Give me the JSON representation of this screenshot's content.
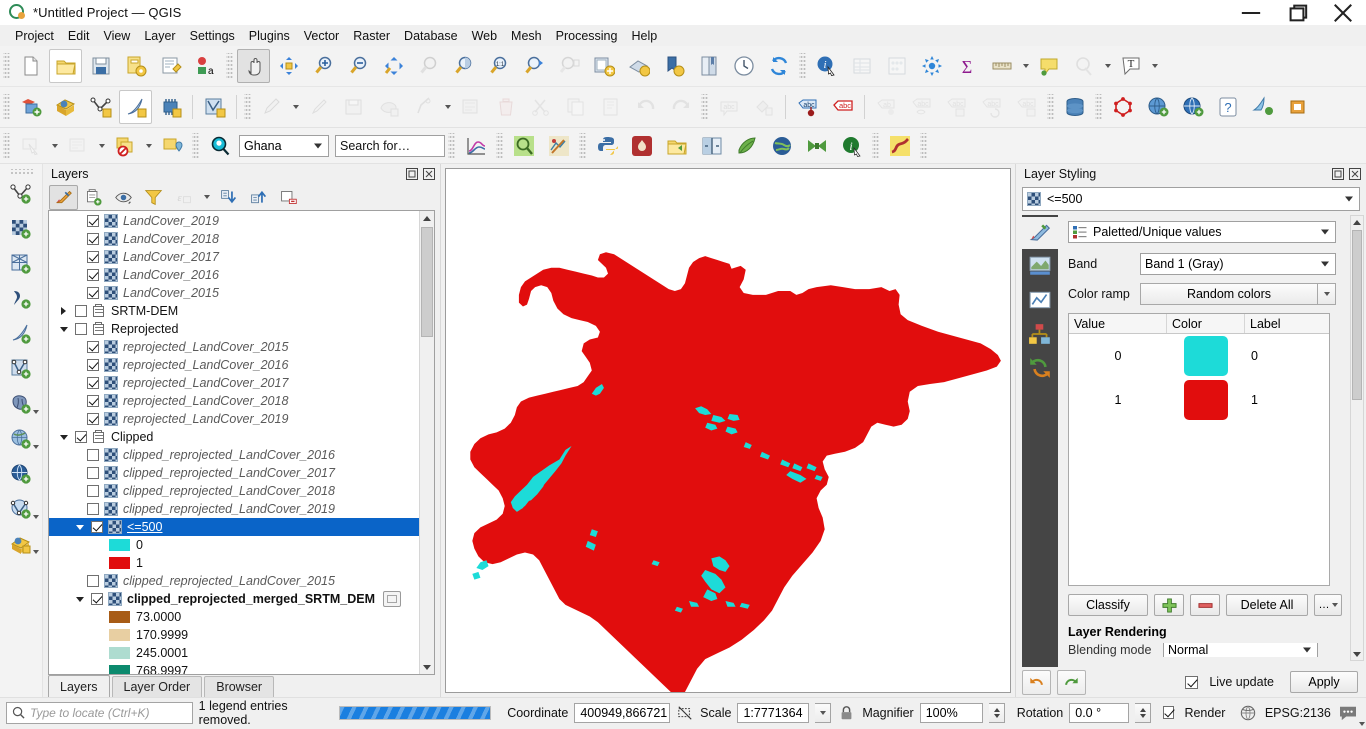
{
  "window": {
    "title": "*Untitled Project — QGIS",
    "minimize": "—",
    "maximize": "❐",
    "close": "✕"
  },
  "menu": [
    "Project",
    "Edit",
    "View",
    "Layer",
    "Settings",
    "Plugins",
    "Vector",
    "Raster",
    "Database",
    "Web",
    "Mesh",
    "Processing",
    "Help"
  ],
  "toolbars": {
    "row1": [
      "new-project-icon",
      "open-project-icon",
      "save-project-icon",
      "save-project-as-icon",
      "new-print-layout-icon",
      "style-manager-icon",
      "pan-map-icon",
      "pan-to-selection-icon",
      "zoom-in-icon",
      "zoom-out-icon",
      "zoom-full-icon",
      "zoom-to-selection-icon",
      "zoom-to-layer-icon",
      "zoom-native-icon",
      "zoom-last-icon",
      "zoom-next-icon",
      "new-map-view-icon",
      "new-3d-map-view-icon",
      "new-bookmark-icon",
      "show-bookmarks-icon",
      "temporal-controller-icon",
      "refresh-icon",
      "identify-features-icon",
      "open-attribute-table-icon",
      "field-calculator-icon",
      "processing-toolbox-icon",
      "statistical-summary-icon",
      "measure-line-icon",
      "map-tips-icon",
      "show-spatial-bookmarks-icon",
      "text-annotation-icon"
    ],
    "row2": [
      "new-shapefile-layer-icon",
      "new-geopackage-layer-icon",
      "new-spatialite-layer-icon",
      "new-gpx-layer-icon",
      "new-memory-layer-icon",
      "new-virtual-layer-icon",
      "current-edits-icon",
      "toggle-editing-icon",
      "save-layer-edits-icon",
      "add-feature-icon",
      "modify-attributes-icon",
      "vertex-tool-icon",
      "delete-selected-icon",
      "cut-features-icon",
      "copy-features-icon",
      "paste-features-icon",
      "undo-icon",
      "redo-icon",
      "label-toolbar-icon",
      "change-label-icon",
      "pin-labels-icon",
      "highlight-labels-icon",
      "move-label-icon",
      "show-hide-labels-icon",
      "move-label-diagram-icon",
      "rotate-label-icon",
      "change-label-properties-icon",
      "db-manager-icon",
      "geometry-checker-icon",
      "metasearch-icon",
      "openstreetmap-icon",
      "georeferencer-icon",
      "help-icon",
      "qgis2web-icon",
      "plugin-icon"
    ],
    "row3": {
      "select-features-icon": true,
      "deselect-icon": true,
      "select-by-value-icon": true,
      "select-by-location-icon": true,
      "locator_search_icon": "search-icon",
      "country_filter": "Ghana",
      "search_placeholder": "Search for…",
      "items": [
        "profile-tool-icon",
        "search-qgis-icon",
        "map-composer-icon",
        "python-console-icon",
        "heatmap-icon",
        "open-data-source-icon",
        "swipe-tool-icon",
        "qgis-leaf-icon",
        "globe-icon",
        "bowtie-icon",
        "info-icon",
        "road-icon"
      ]
    }
  },
  "left_toolbar": [
    "add-vector-layer-icon",
    "add-raster-layer-icon",
    "add-mesh-layer-icon",
    "add-delimited-text-layer-icon",
    "add-spatialite-layer-icon",
    "add-vector-tile-layer-icon",
    "add-postgis-layer-icon",
    "add-wms-layer-icon",
    "add-wfs-layer-icon",
    "add-wcs-layer-icon",
    "add-arcgis-layer-icon"
  ],
  "layers_panel": {
    "title": "Layers",
    "toolbar": [
      "open-layer-styling-icon",
      "add-group-icon",
      "manage-visibility-icon",
      "filter-legend-icon",
      "filter-legend-expression-icon",
      "expand-all-icon",
      "collapse-all-icon",
      "remove-layer-icon"
    ],
    "tabs": [
      {
        "label": "Layers",
        "active": true
      },
      {
        "label": "Layer Order",
        "active": false
      },
      {
        "label": "Browser",
        "active": false
      }
    ],
    "tree": [
      {
        "indent": 2,
        "type": "layer",
        "checked": true,
        "label": "LandCover_2019",
        "italic": true
      },
      {
        "indent": 2,
        "type": "layer",
        "checked": true,
        "label": "LandCover_2018",
        "italic": true
      },
      {
        "indent": 2,
        "type": "layer",
        "checked": true,
        "label": "LandCover_2017",
        "italic": true
      },
      {
        "indent": 2,
        "type": "layer",
        "checked": true,
        "label": "LandCover_2016",
        "italic": true
      },
      {
        "indent": 2,
        "type": "layer",
        "checked": true,
        "label": "LandCover_2015",
        "italic": true
      },
      {
        "indent": 0,
        "type": "group",
        "checked": false,
        "label": "SRTM-DEM",
        "expander": "collapsed"
      },
      {
        "indent": 0,
        "type": "group",
        "checked": false,
        "label": "Reprojected",
        "expander": "expanded"
      },
      {
        "indent": 2,
        "type": "layer",
        "checked": true,
        "label": "reprojected_LandCover_2015",
        "italic": true
      },
      {
        "indent": 2,
        "type": "layer",
        "checked": true,
        "label": "reprojected_LandCover_2016",
        "italic": true
      },
      {
        "indent": 2,
        "type": "layer",
        "checked": true,
        "label": "reprojected_LandCover_2017",
        "italic": true
      },
      {
        "indent": 2,
        "type": "layer",
        "checked": true,
        "label": "reprojected_LandCover_2018",
        "italic": true
      },
      {
        "indent": 2,
        "type": "layer",
        "checked": true,
        "label": "reprojected_LandCover_2019",
        "italic": true
      },
      {
        "indent": 0,
        "type": "group",
        "checked": true,
        "label": "Clipped",
        "expander": "expanded"
      },
      {
        "indent": 2,
        "type": "layer",
        "checked": false,
        "label": "clipped_reprojected_LandCover_2016",
        "italic": true
      },
      {
        "indent": 2,
        "type": "layer",
        "checked": false,
        "label": "clipped_reprojected_LandCover_2017",
        "italic": true
      },
      {
        "indent": 2,
        "type": "layer",
        "checked": false,
        "label": "clipped_reprojected_LandCover_2018",
        "italic": true
      },
      {
        "indent": 2,
        "type": "layer",
        "checked": false,
        "label": "clipped_reprojected_LandCover_2019",
        "italic": true
      },
      {
        "indent": 1,
        "type": "layer",
        "checked": true,
        "label": "<=500",
        "selected": true,
        "expander": "expanded"
      },
      {
        "indent": 3,
        "type": "symbol",
        "swatch": "#1ddbd8",
        "label": "0"
      },
      {
        "indent": 3,
        "type": "symbol",
        "swatch": "#e10d0d",
        "label": "1"
      },
      {
        "indent": 2,
        "type": "layer",
        "checked": false,
        "label": "clipped_reprojected_LandCover_2015",
        "italic": true
      },
      {
        "indent": 1,
        "type": "layer",
        "checked": true,
        "label": "clipped_reprojected_merged_SRTM_DEM",
        "bold": true,
        "expander": "expanded",
        "badge": "memory-chip-icon"
      },
      {
        "indent": 3,
        "type": "symbol",
        "swatch": "#a85c16",
        "label": "73.0000"
      },
      {
        "indent": 3,
        "type": "symbol",
        "swatch": "#e8cfa2",
        "label": "170.9999"
      },
      {
        "indent": 3,
        "type": "symbol",
        "swatch": "#aedcd0",
        "label": "245.0001"
      },
      {
        "indent": 3,
        "type": "symbol",
        "swatch": "#0c8a6e",
        "label": "768.9997"
      }
    ]
  },
  "style_panel": {
    "title": "Layer Styling",
    "layer_selector": "<=500",
    "side_tabs": [
      "symbology-icon",
      "transparency-icon",
      "histogram-icon",
      "rendering-icon",
      "undo-redo-history-icon"
    ],
    "renderer": "Paletted/Unique values",
    "band_label": "Band",
    "band_value": "Band 1 (Gray)",
    "color_ramp_label": "Color ramp",
    "color_ramp_value": "Random colors",
    "table": {
      "headers": [
        "Value",
        "Color",
        "Label"
      ],
      "rows": [
        {
          "value": "0",
          "color": "#1ddbd8",
          "label": "0"
        },
        {
          "value": "1",
          "color": "#e10d0d",
          "label": "1"
        }
      ]
    },
    "buttons": {
      "classify": "Classify",
      "add": "add-entry-icon",
      "remove": "remove-entry-icon",
      "delete_all": "Delete All",
      "more": "…"
    },
    "layer_rendering_title": "Layer Rendering",
    "blending_label": "Blending mode",
    "blending_value": "Normal",
    "footer": {
      "undo": "undo-style-icon",
      "redo": "redo-style-icon",
      "live_update_label": "Live update",
      "live_update_checked": true,
      "apply_label": "Apply"
    }
  },
  "statusbar": {
    "locate_placeholder": "Type to locate (Ctrl+K)",
    "message": "1 legend entries removed.",
    "progress_percent": 100,
    "coordinate_label": "Coordinate",
    "coordinate_value": "400949,866721",
    "scale_label": "Scale",
    "scale_value": "1:7771364",
    "magnifier_label": "Magnifier",
    "magnifier_value": "100%",
    "rotation_label": "Rotation",
    "rotation_value": "0.0 °",
    "render_label": "Render",
    "render_checked": true,
    "crs_label": "EPSG:2136",
    "messages_icon": "messages-icon",
    "lock_icon": "lock-icon",
    "crs_icon": "globe-icon"
  },
  "map": {
    "background": "#ffffff",
    "fill_color": "#e10d0d",
    "water_color": "#1ddbd8"
  }
}
